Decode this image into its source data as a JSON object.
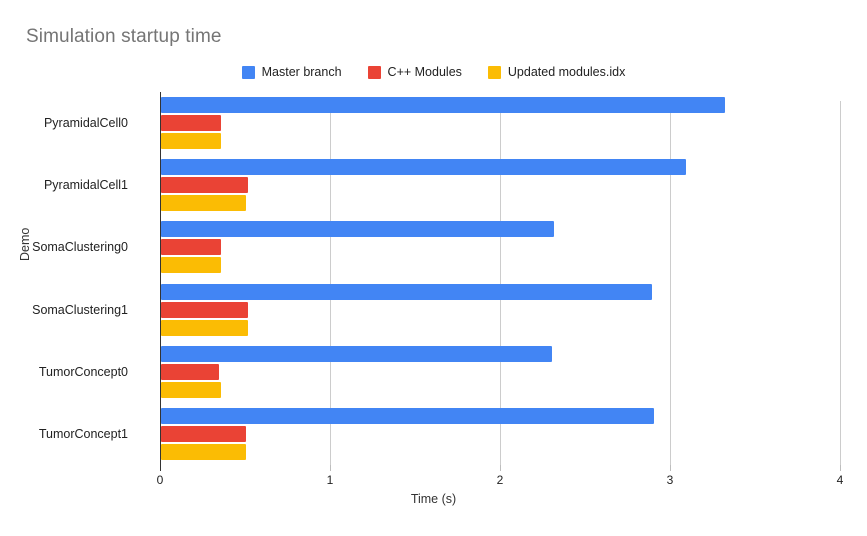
{
  "chart_data": {
    "type": "bar",
    "orientation": "horizontal",
    "title": "Simulation startup time",
    "xlabel": "Time (s)",
    "ylabel": "Demo",
    "xlim": [
      0,
      4
    ],
    "xticks": [
      "0",
      "1",
      "2",
      "3",
      "4"
    ],
    "grid": true,
    "legend_position": "top-center",
    "categories": [
      "PyramidalCell0",
      "PyramidalCell1",
      "SomaClustering0",
      "SomaClustering1",
      "TumorConcept0",
      "TumorConcept1"
    ],
    "series": [
      {
        "name": "Master branch",
        "color": "#4285F4",
        "values": [
          3.32,
          3.09,
          2.31,
          2.89,
          2.3,
          2.9
        ]
      },
      {
        "name": "C++ Modules",
        "color": "#EA4335",
        "values": [
          0.35,
          0.51,
          0.35,
          0.51,
          0.34,
          0.5
        ]
      },
      {
        "name": "Updated modules.idx",
        "color": "#FBBC04",
        "values": [
          0.35,
          0.5,
          0.35,
          0.51,
          0.35,
          0.5
        ]
      }
    ]
  }
}
